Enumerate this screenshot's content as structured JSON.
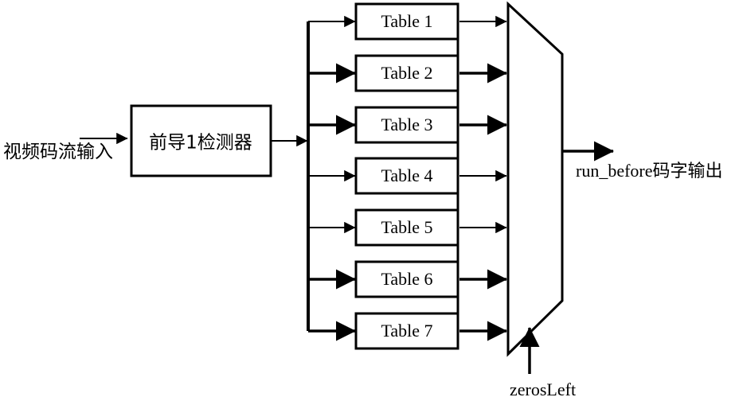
{
  "diagram": {
    "title": "run_before codeword decoding block diagram",
    "colors": {
      "stroke": "#000000",
      "background": "#ffffff",
      "fill": "#ffffff"
    },
    "input": {
      "label": "视频码流输入",
      "arrow_name": "input-arrow"
    },
    "detector": {
      "label": "前导1检测器"
    },
    "tables": [
      {
        "label": "Table 1"
      },
      {
        "label": "Table 2"
      },
      {
        "label": "Table 3"
      },
      {
        "label": "Table 4"
      },
      {
        "label": "Table 5"
      },
      {
        "label": "Table 6"
      },
      {
        "label": "Table 7"
      }
    ],
    "mux": {
      "name": "multiplexer",
      "select_label": "zerosLeft"
    },
    "output": {
      "label": "run_before码字输出"
    }
  }
}
